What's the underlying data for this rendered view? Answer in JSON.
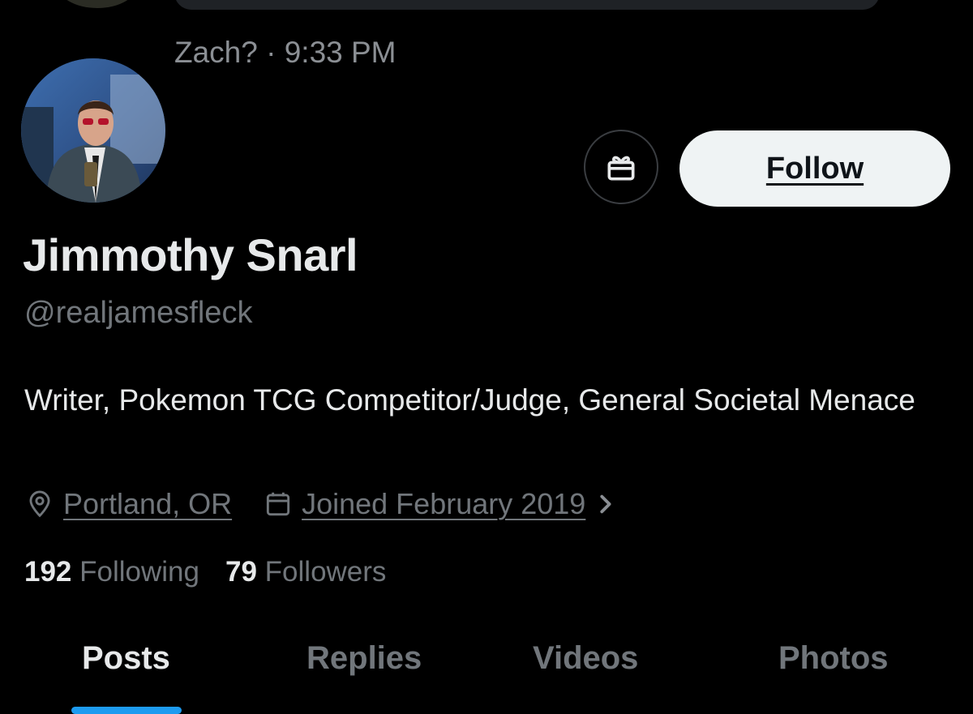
{
  "preview": {
    "meta": "Zach? · 9:33 PM"
  },
  "profile": {
    "display_name": "Jimmothy Snarl",
    "handle": "@realjamesfleck",
    "bio": "Writer, Pokemon TCG Competitor/Judge, General Societal Menace",
    "location": "Portland, OR",
    "joined": "Joined February 2019",
    "following_count": "192",
    "following_label": "Following",
    "followers_count": "79",
    "followers_label": "Followers"
  },
  "actions": {
    "gift_icon": "gift-icon",
    "follow_label": "Follow"
  },
  "icons": {
    "location": "map-pin-icon",
    "calendar": "calendar-icon",
    "chevron": "chevron-right-icon"
  },
  "tabs": [
    {
      "label": "Posts",
      "active": true
    },
    {
      "label": "Replies",
      "active": false
    },
    {
      "label": "Videos",
      "active": false
    },
    {
      "label": "Photos",
      "active": false
    }
  ],
  "colors": {
    "background": "#000000",
    "text_primary": "#e7e9ea",
    "text_secondary": "#71767b",
    "follow_bg": "#eff3f4",
    "accent": "#1d9bf0"
  }
}
